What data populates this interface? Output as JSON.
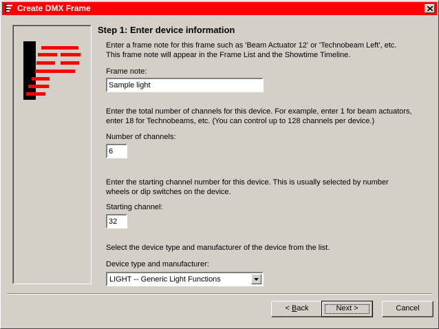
{
  "window": {
    "title": "Create DMX Frame",
    "accent_color": "#fe0000"
  },
  "heading": "Step 1: Enter device information",
  "frame_note": {
    "description_line1": "Enter a frame note for this frame such as 'Beam Actuator 12' or 'Technobeam Left', etc.",
    "description_line2": "This frame note will appear in the Frame List and the Showtime Timeline.",
    "label": "Frame note:",
    "value": "Sample light"
  },
  "channels": {
    "description_line1": "Enter the total number of channels for this device. For example, enter 1 for beam actuators,",
    "description_line2": "enter 18 for Technobeams, etc. (You can control up to 128 channels per device.)",
    "label": "Number of channels:",
    "value": "6"
  },
  "start_channel": {
    "description_line1": "Enter the starting channel number for this device. This is usually selected by number",
    "description_line2": "wheels or dip switches on the device.",
    "label": "Starting channel:",
    "value": "32"
  },
  "device_type": {
    "description": "Select the device type and manufacturer of the device from the list.",
    "label": "Device type and manufacturer:",
    "selected": "LIGHT -- Generic Light Functions"
  },
  "buttons": {
    "back_mnemonic": "B",
    "back_rest": "ack",
    "back_prefix": "< ",
    "next_label": "Next >",
    "cancel_label": "Cancel"
  }
}
